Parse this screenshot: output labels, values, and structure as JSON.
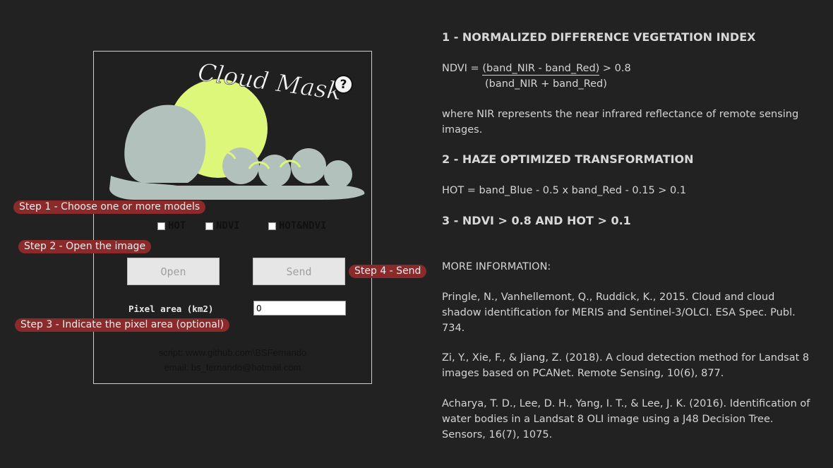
{
  "app": {
    "logo_text": "Cloud Mask",
    "help_icon": "question-circle-icon",
    "help_label": "?",
    "models": [
      {
        "label": "HOT",
        "checked": false
      },
      {
        "label": "NDVI",
        "checked": false
      },
      {
        "label": "HOT&NDVI",
        "checked": false
      }
    ],
    "open_label": "Open",
    "send_label": "Send",
    "pixel_area_label": "Pixel area (km2)",
    "pixel_area_value": "0",
    "credit_script": "script: www.github.com\\BSFernando",
    "credit_email": "email: bs_fernando@hotmail.com"
  },
  "steps": {
    "step1": "Step 1 - Choose one or more models",
    "step2": "Step 2 - Open the image",
    "step3": "Step 3 - Indicate the pixel area (optional)",
    "step4": "Step 4 - Send"
  },
  "info": {
    "section1_title": "1 - NORMALIZED DIFFERENCE VEGETATION INDEX",
    "ndvi_prefix": "NDVI = ",
    "ndvi_numerator": "(band_NIR - band_Red)",
    "ndvi_condition": " > 0.8",
    "ndvi_denominator": "(band_NIR + band_Red)",
    "ndvi_note": "where NIR represents the near infrared reflectance of remote sensing images.",
    "section2_title": "2 - HAZE OPTIMIZED TRANSFORMATION",
    "hot_formula": "HOT = band_Blue - 0.5 x band_Red - 0.15  > 0.1",
    "section3_title": "3 - NDVI > 0.8 AND HOT > 0.1",
    "more_info": "MORE INFORMATION:",
    "refs": [
      "Pringle, N., Vanhellemont, Q., Ruddick, K., 2015. Cloud and cloud shadow identification for MERIS and Sentinel-3/OLCI. ESA Spec. Publ. 734.",
      "Zi, Y., Xie, F., & Jiang, Z. (2018). A cloud detection method for Landsat 8 images based on PCANet. Remote Sensing, 10(6), 877.",
      "Acharya, T. D., Lee, D. H., Yang, I. T., & Lee, J. K. (2016). Identification of water bodies in a Landsat 8 OLI image using a J48 Decision Tree. Sensors, 16(7), 1075."
    ]
  },
  "colors": {
    "background": "#222222",
    "sun": "#dcf779",
    "cloud": "#b3c1bc",
    "step_tag": "#8b2a2a"
  }
}
